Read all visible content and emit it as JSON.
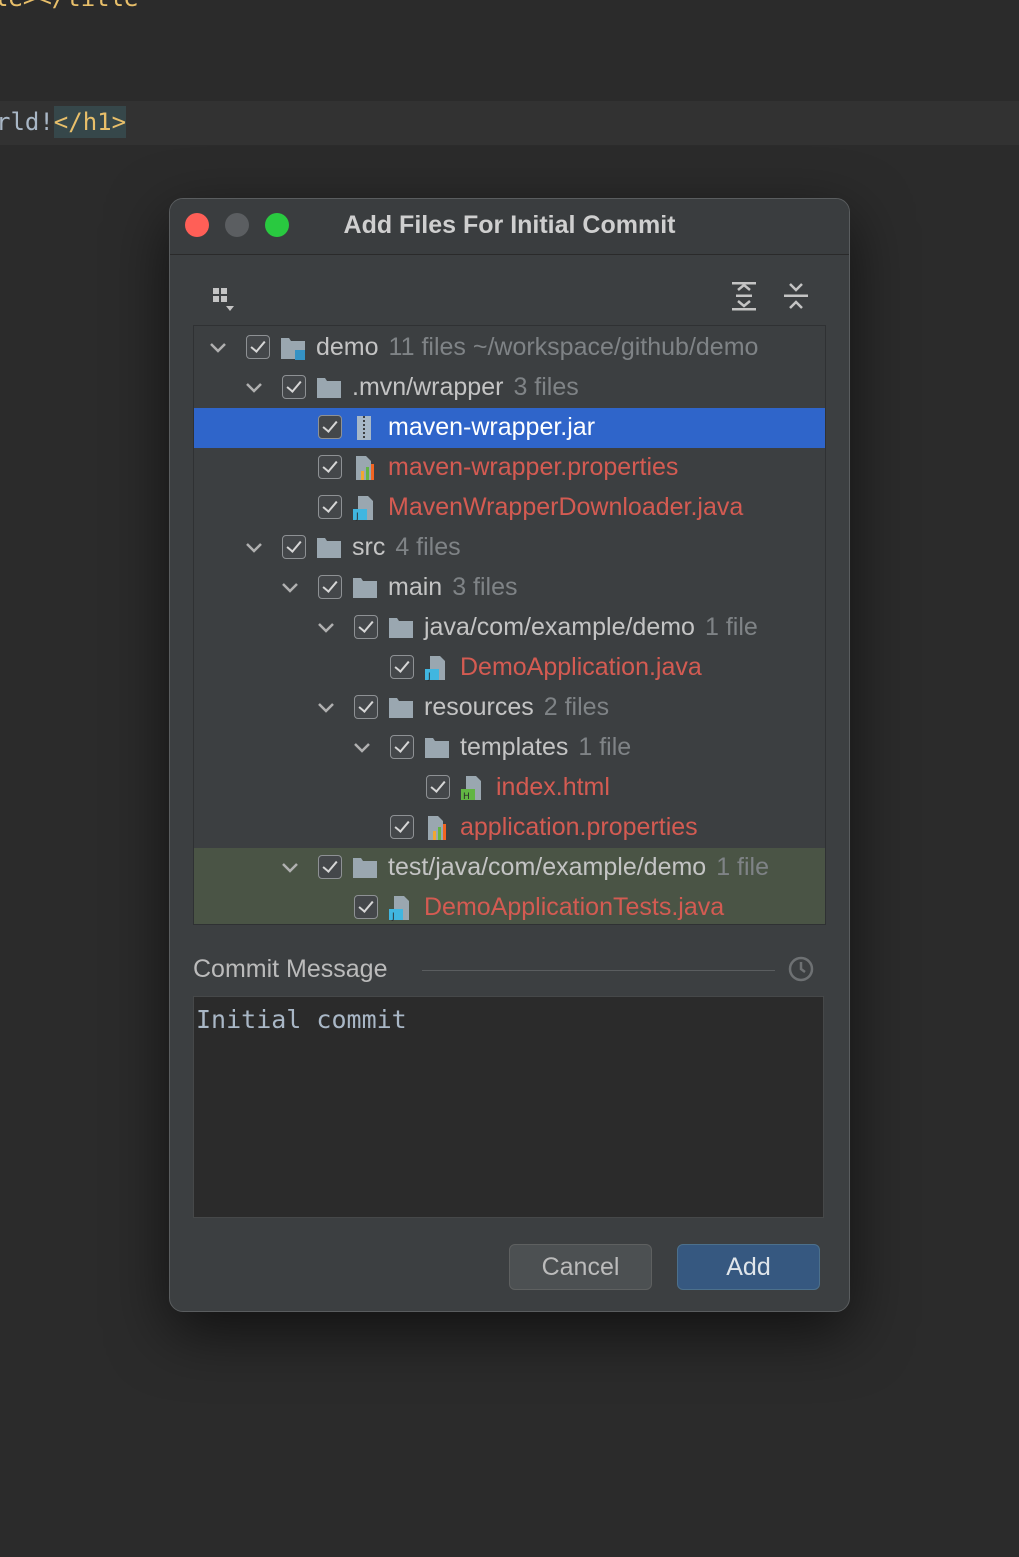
{
  "editor": {
    "top_fragment": "le></title",
    "line_text": "rld!",
    "line_tag": "</h1>"
  },
  "dialog": {
    "title": "Add Files For Initial Commit",
    "tree": [
      {
        "name": "demo",
        "meta": "11 files  ~/workspace/github/demo",
        "type": "module",
        "color": "normal"
      },
      {
        "name": ".mvn/wrapper",
        "meta": "3 files",
        "type": "folder",
        "color": "normal"
      },
      {
        "name": "maven-wrapper.jar",
        "meta": "",
        "type": "jar",
        "color": "white"
      },
      {
        "name": "maven-wrapper.properties",
        "meta": "",
        "type": "properties",
        "color": "red"
      },
      {
        "name": "MavenWrapperDownloader.java",
        "meta": "",
        "type": "java",
        "color": "red"
      },
      {
        "name": "src",
        "meta": "4 files",
        "type": "folder",
        "color": "normal"
      },
      {
        "name": "main",
        "meta": "3 files",
        "type": "folder",
        "color": "normal"
      },
      {
        "name": "java/com/example/demo",
        "meta": "1 file",
        "type": "folder",
        "color": "normal"
      },
      {
        "name": "DemoApplication.java",
        "meta": "",
        "type": "java",
        "color": "red"
      },
      {
        "name": "resources",
        "meta": "2 files",
        "type": "folder",
        "color": "normal"
      },
      {
        "name": "templates",
        "meta": "1 file",
        "type": "folder",
        "color": "normal"
      },
      {
        "name": "index.html",
        "meta": "",
        "type": "html",
        "color": "red"
      },
      {
        "name": "application.properties",
        "meta": "",
        "type": "properties",
        "color": "red"
      },
      {
        "name": "test/java/com/example/demo",
        "meta": "1 file",
        "type": "folder",
        "color": "normal"
      },
      {
        "name": "DemoApplicationTests.java",
        "meta": "",
        "type": "java",
        "color": "red"
      }
    ],
    "commit_message_label": "Commit Message",
    "commit_message": "Initial commit",
    "cancel_label": "Cancel",
    "add_label": "Add"
  }
}
